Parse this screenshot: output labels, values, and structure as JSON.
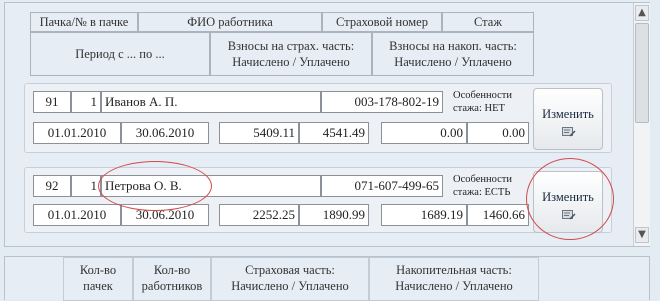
{
  "header": {
    "col_pack": "Пачка/№ в пачке",
    "col_fio": "ФИО работника",
    "col_snils": "Страховой номер",
    "col_stazh": "Стаж",
    "col_period": "Период с ... по ...",
    "col_ins_line1": "Взносы на страх. часть:",
    "col_ins_line2": "Начислено / Уплачено",
    "col_acc_line1": "Взносы на накоп. часть:",
    "col_acc_line2": "Начислено / Уплачено"
  },
  "records": [
    {
      "pack": "91",
      "num": "1",
      "name": "Иванов А. П.",
      "snils": "003-178-802-19",
      "feature_line1": "Особенности",
      "feature_line2": "стажа:  НЕТ",
      "date_from": "01.01.2010",
      "date_to": "30.06.2010",
      "ins_accrued": "5409.11",
      "ins_paid": "4541.49",
      "acc_accrued": "0.00",
      "acc_paid": "0.00",
      "button": "Изменить"
    },
    {
      "pack": "92",
      "num": "1",
      "name": "Петрова О. В.",
      "snils": "071-607-499-65",
      "feature_line1": "Особенности",
      "feature_line2": "стажа: ЕСТЬ",
      "date_from": "01.01.2010",
      "date_to": "30.06.2010",
      "ins_accrued": "2252.25",
      "ins_paid": "1890.99",
      "acc_accrued": "1689.19",
      "acc_paid": "1460.66",
      "button": "Изменить"
    }
  ],
  "footer": {
    "packs_line1": "Кол-во",
    "packs_line2": "пачек",
    "workers_line1": "Кол-во",
    "workers_line2": "работников",
    "ins_line1": "Страховая часть:",
    "ins_line2": "Начислено / Уплачено",
    "acc_line1": "Накопительная часть:",
    "acc_line2": "Начислено / Уплачено"
  },
  "scrollbar": {
    "up_arrow": "▲",
    "down_arrow": "▼"
  },
  "colors": {
    "background": "#e3ebf3",
    "annotation": "#d24a4a"
  },
  "icons": [
    "edit-icon",
    "scroll-up-icon",
    "scroll-down-icon"
  ]
}
